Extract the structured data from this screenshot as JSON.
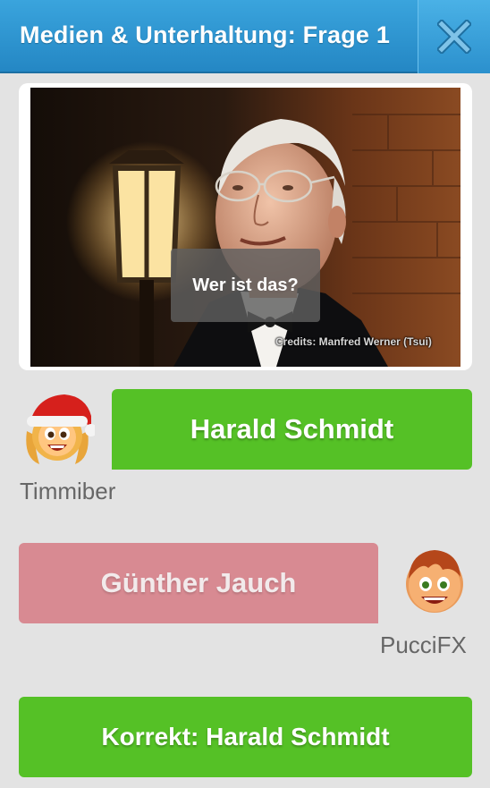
{
  "header": {
    "title": "Medien & Unterhaltung: Frage 1",
    "close_icon": "close-x-icon",
    "color": "#2b93d1"
  },
  "photo": {
    "question": "Wer ist das?",
    "credits": "Credits: Manfred Werner (Tsui)"
  },
  "answers": [
    {
      "label": "Harald Schmidt",
      "player": "Timmiber",
      "color": "#55c126"
    },
    {
      "label": "Günther Jauch",
      "player": "PucciFX",
      "color": "#d88a92"
    }
  ],
  "result": {
    "label": "Korrekt: Harald Schmidt",
    "color": "#55c126"
  },
  "avatars": {
    "player1": "santa-girl-avatar",
    "player2": "boy-avatar"
  }
}
